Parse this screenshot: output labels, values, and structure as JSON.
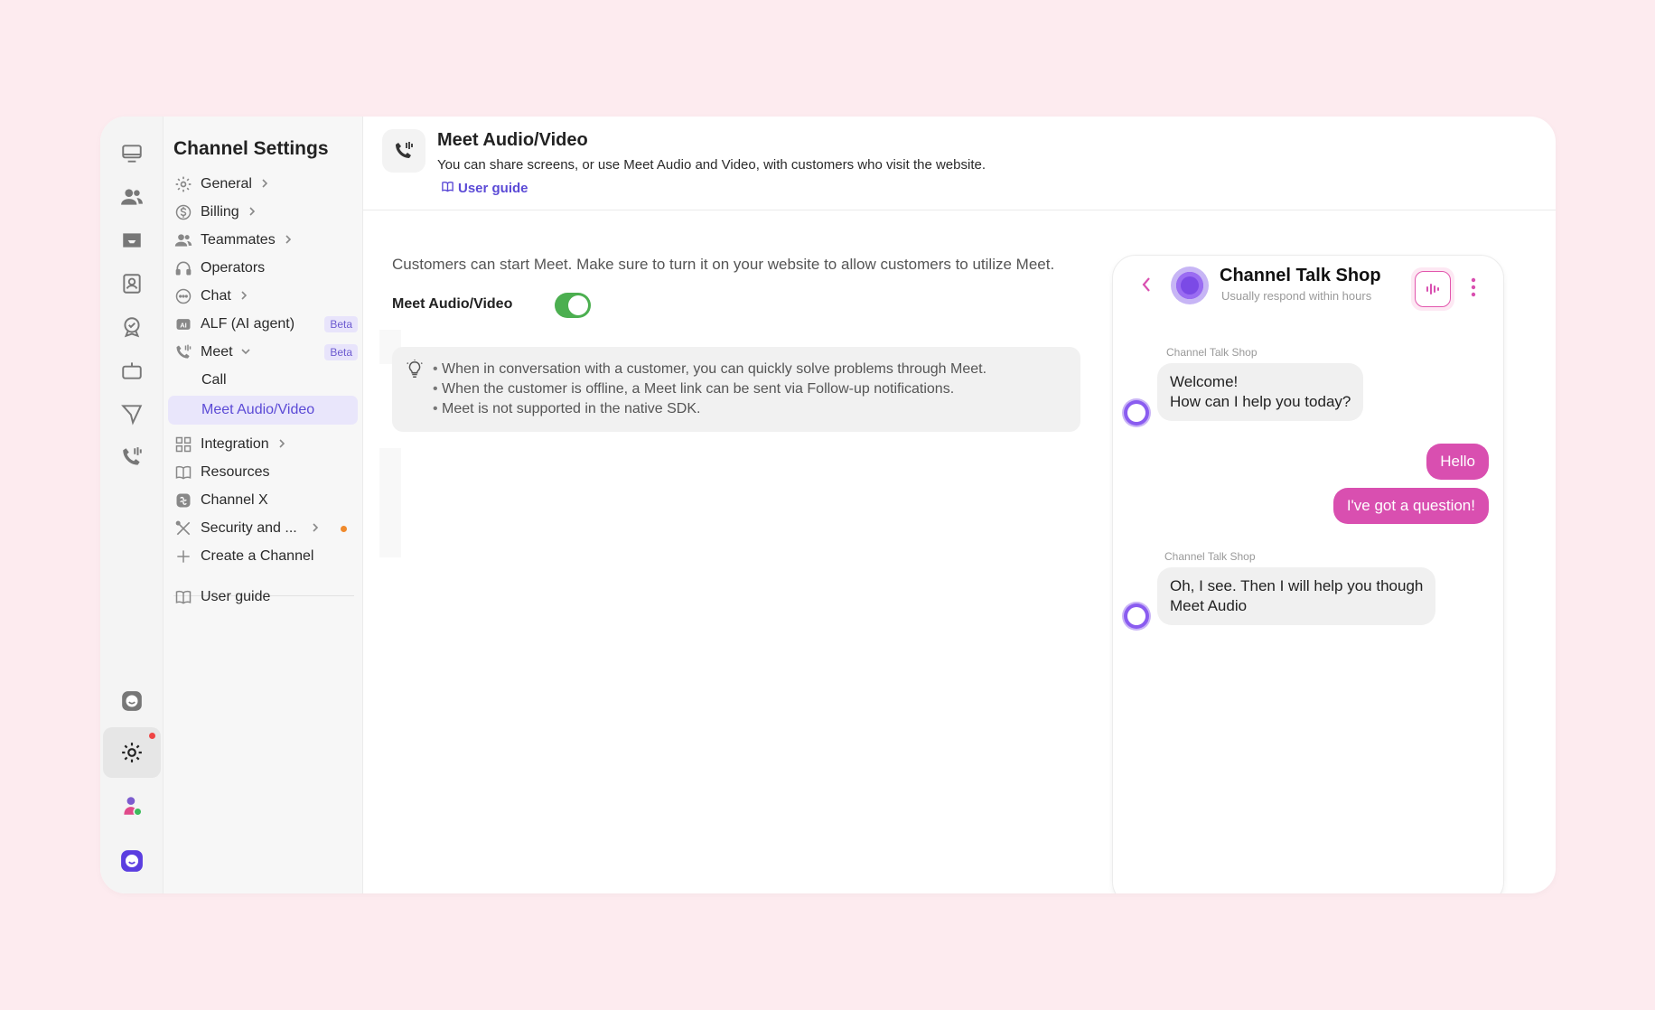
{
  "nav": {
    "title": "Channel Settings",
    "items": [
      {
        "label": "General"
      },
      {
        "label": "Billing"
      },
      {
        "label": "Teammates"
      },
      {
        "label": "Operators"
      },
      {
        "label": "Chat"
      },
      {
        "label": "ALF (AI agent)",
        "badge": "Beta"
      },
      {
        "label": "Meet",
        "badge": "Beta"
      },
      {
        "label": "Call"
      },
      {
        "label": "Meet Audio/Video"
      },
      {
        "label": "Integration"
      },
      {
        "label": "Resources"
      },
      {
        "label": "Channel X"
      },
      {
        "label": "Security and ..."
      },
      {
        "label": "Create a Channel"
      },
      {
        "label": "User guide"
      }
    ]
  },
  "header": {
    "title": "Meet Audio/Video",
    "description": "You can share screens, or use Meet Audio and Video, with customers who visit the website.",
    "guide": "User guide"
  },
  "content": {
    "description": "Customers can start Meet. Make sure to turn it on your website to allow customers to utilize Meet.",
    "toggle_label": "Meet Audio/Video",
    "toggle_on": true,
    "tips": [
      "When in conversation with a customer, you can quickly solve problems through Meet.",
      "When the customer is offline, a Meet link can be sent via Follow-up notifications.",
      "Meet is not supported in the native SDK."
    ]
  },
  "preview": {
    "name": "Channel Talk Shop",
    "status": "Usually respond within hours",
    "messages": [
      {
        "from": "Channel Talk Shop",
        "line1": "Welcome!",
        "line2": "How can I help you today?"
      },
      {
        "text": "Hello"
      },
      {
        "text": "I've got a question!"
      },
      {
        "from": "Channel Talk Shop",
        "line1": "Oh, I see. Then I will help you though",
        "line2": "Meet Audio"
      }
    ]
  },
  "colors": {
    "accent": "#5b4ad6",
    "brand_pink": "#d94fb0",
    "toggle": "#4caf50",
    "background": "#fdebef"
  }
}
